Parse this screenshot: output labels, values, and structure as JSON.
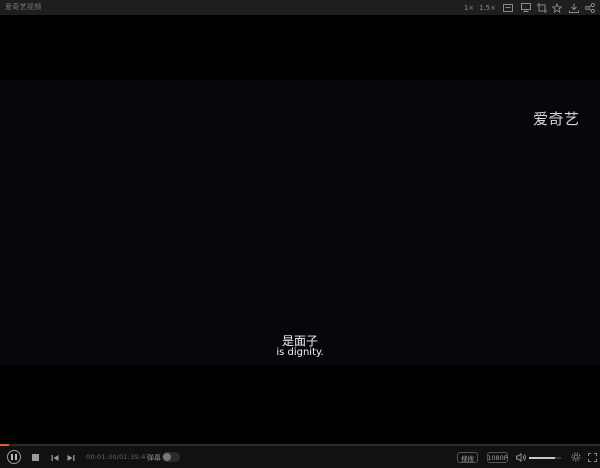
{
  "window": {
    "title": "爱奇艺视频",
    "toolbar": {
      "speed_label": "1×",
      "speed15_label": "1.5×"
    }
  },
  "video": {
    "watermark": "爱奇艺",
    "subtitle_cn": "是面子",
    "subtitle_en": "is dignity."
  },
  "controls": {
    "time": "00:01:30/01:39:47",
    "danmu_label": "弹幕",
    "search_label": "搜搜",
    "quality_label": "1080P",
    "progress_fraction": 0.015,
    "volume_fraction": 0.8,
    "accent_color": "#e0601e"
  },
  "icons": {
    "titlebar": [
      "screen-icon",
      "crop-icon",
      "rotate-icon",
      "star-icon",
      "download-icon",
      "share-icon"
    ],
    "controlbar": [
      "play-pause-icon",
      "stop-icon",
      "prev-icon",
      "next-icon",
      "volume-icon",
      "settings-icon",
      "fullscreen-icon"
    ]
  }
}
